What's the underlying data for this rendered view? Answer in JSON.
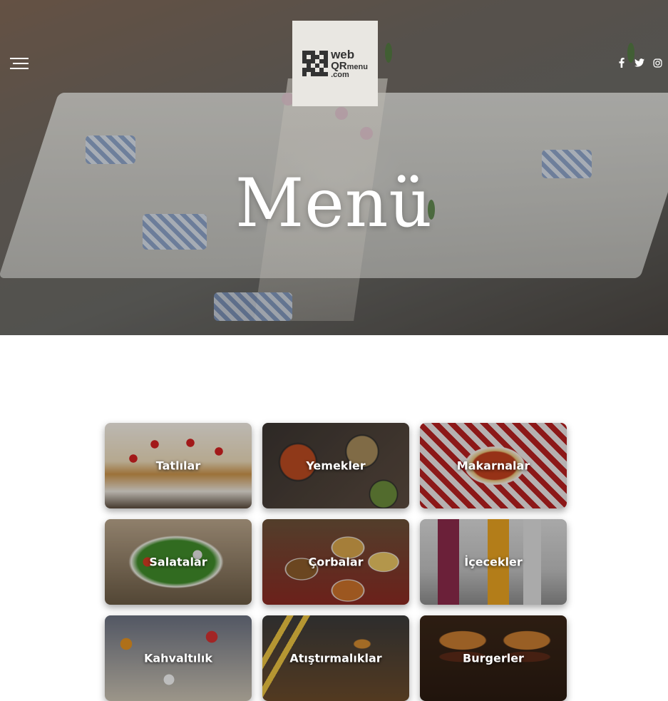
{
  "header": {
    "menu_icon": "hamburger-icon",
    "logo": {
      "line1": "web",
      "line2a": "QR",
      "line2b": "menu",
      "line3": ".com"
    },
    "title": "Menü",
    "social": [
      {
        "icon": "facebook-icon"
      },
      {
        "icon": "twitter-icon"
      },
      {
        "icon": "instagram-icon"
      }
    ]
  },
  "categories": [
    {
      "label": "Tatlılar"
    },
    {
      "label": "Yemekler"
    },
    {
      "label": "Makarnalar"
    },
    {
      "label": "Salatalar"
    },
    {
      "label": "Çorbalar"
    },
    {
      "label": "İçecekler"
    },
    {
      "label": "Kahvaltılık"
    },
    {
      "label": "Atıştırmalıklar"
    },
    {
      "label": "Burgerler"
    }
  ],
  "colors": {
    "background": "#ffffff",
    "logo_bg": "#e9e7e2",
    "text_light": "#ffffff"
  }
}
